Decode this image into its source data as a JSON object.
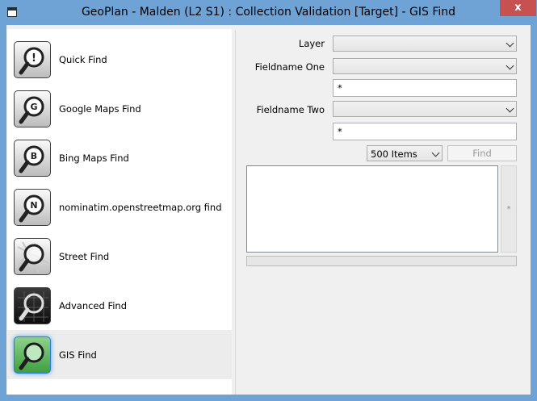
{
  "window": {
    "title": "GeoPlan - Malden (L2 S1) : Collection Validation  [Target] - GIS Find",
    "close_glyph": "x"
  },
  "find_list": {
    "items": [
      {
        "label": "Quick Find",
        "icon": "quick-find-icon",
        "badge": "!"
      },
      {
        "label": "Google Maps Find",
        "icon": "google-maps-find-icon",
        "badge": "G"
      },
      {
        "label": "Bing Maps Find",
        "icon": "bing-maps-find-icon",
        "badge": "B"
      },
      {
        "label": "nominatim.openstreetmap.org find",
        "icon": "nominatim-find-icon",
        "badge": "N"
      },
      {
        "label": "Street Find",
        "icon": "street-find-icon",
        "badge": ""
      },
      {
        "label": "Advanced Find",
        "icon": "advanced-find-icon",
        "badge": ""
      },
      {
        "label": "GIS Find",
        "icon": "gis-find-icon",
        "badge": ""
      }
    ],
    "selected": "GIS Find"
  },
  "form": {
    "layer_label": "Layer",
    "layer_value": "",
    "fieldname_one_label": "Fieldname One",
    "fieldname_one_value": "",
    "fieldname_one_text": "*",
    "fieldname_two_label": "Fieldname Two",
    "fieldname_two_value": "",
    "fieldname_two_text": "*",
    "items_value": "500 Items",
    "find_label": "Find",
    "side_strip_text": "*"
  },
  "colors": {
    "titlebar": "#6fa3d6",
    "close_button": "#c75050",
    "selected_icon": "#5cb85c"
  }
}
